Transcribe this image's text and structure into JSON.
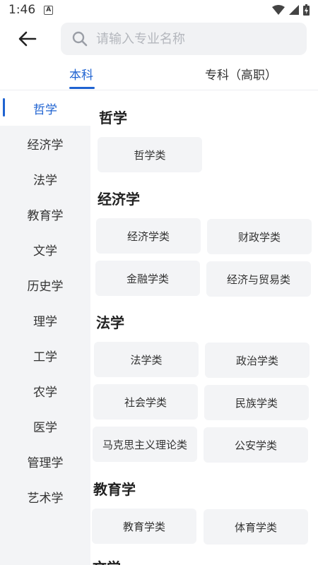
{
  "status_bar": {
    "time": "1:46",
    "notification_icon": "A",
    "icons": [
      "wifi-icon",
      "signal-icon",
      "battery-charging-icon"
    ]
  },
  "header": {
    "search": {
      "placeholder": "请输入专业名称"
    }
  },
  "tabs": [
    {
      "label": "本科",
      "active": true
    },
    {
      "label": "专科（高职）",
      "active": false
    }
  ],
  "sidebar": {
    "items": [
      {
        "label": "哲学",
        "active": true
      },
      {
        "label": "经济学"
      },
      {
        "label": "法学"
      },
      {
        "label": "教育学"
      },
      {
        "label": "文学"
      },
      {
        "label": "历史学"
      },
      {
        "label": "理学"
      },
      {
        "label": "工学"
      },
      {
        "label": "农学"
      },
      {
        "label": "医学"
      },
      {
        "label": "管理学"
      },
      {
        "label": "艺术学"
      }
    ]
  },
  "sections": [
    {
      "title": "哲学",
      "items": [
        "哲学类"
      ]
    },
    {
      "title": "经济学",
      "items": [
        "经济学类",
        "财政学类",
        "金融学类",
        "经济与贸易类"
      ]
    },
    {
      "title": "法学",
      "items": [
        "法学类",
        "政治学类",
        "社会学类",
        "民族学类",
        "马克思主义理论类",
        "公安学类"
      ]
    },
    {
      "title": "教育学",
      "items": [
        "教育学类",
        "体育学类"
      ]
    },
    {
      "title": "文学",
      "items": []
    }
  ],
  "colors": {
    "accent": "#1f63d1",
    "sidebar_bg": "#f3f4f6",
    "chip_bg": "#f3f4f6"
  }
}
